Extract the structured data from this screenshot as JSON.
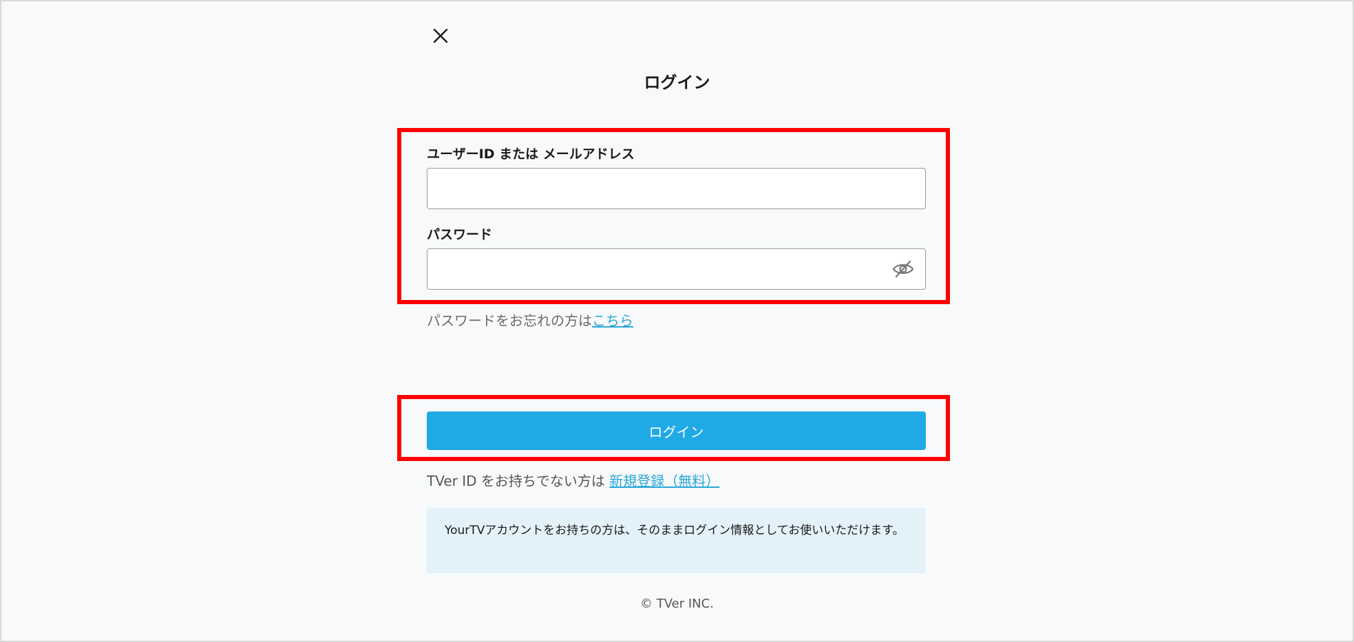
{
  "page": {
    "title": "ログイン"
  },
  "icons": {
    "close": "close-icon",
    "password_visibility": "eye-slash-icon"
  },
  "form": {
    "user_label": "ユーザーID または メールアドレス",
    "user_value": "",
    "user_placeholder": "",
    "password_label": "パスワード",
    "password_value": "",
    "password_placeholder": ""
  },
  "forgot": {
    "text": "パスワードをお忘れの方は",
    "link": "こちら"
  },
  "login_button": "ログイン",
  "register": {
    "text": "TVer ID をお持ちでない方は ",
    "link": "新規登録（無料）"
  },
  "info": {
    "text": "YourTVアカウントをお持ちの方は、そのままログイン情報としてお使いいただけます。"
  },
  "footer": {
    "copyright": "© TVer INC."
  },
  "colors": {
    "accent": "#20aae5",
    "link": "#2ba6d8",
    "highlight": "#ff0000",
    "info_bg": "#e3f2f9"
  }
}
